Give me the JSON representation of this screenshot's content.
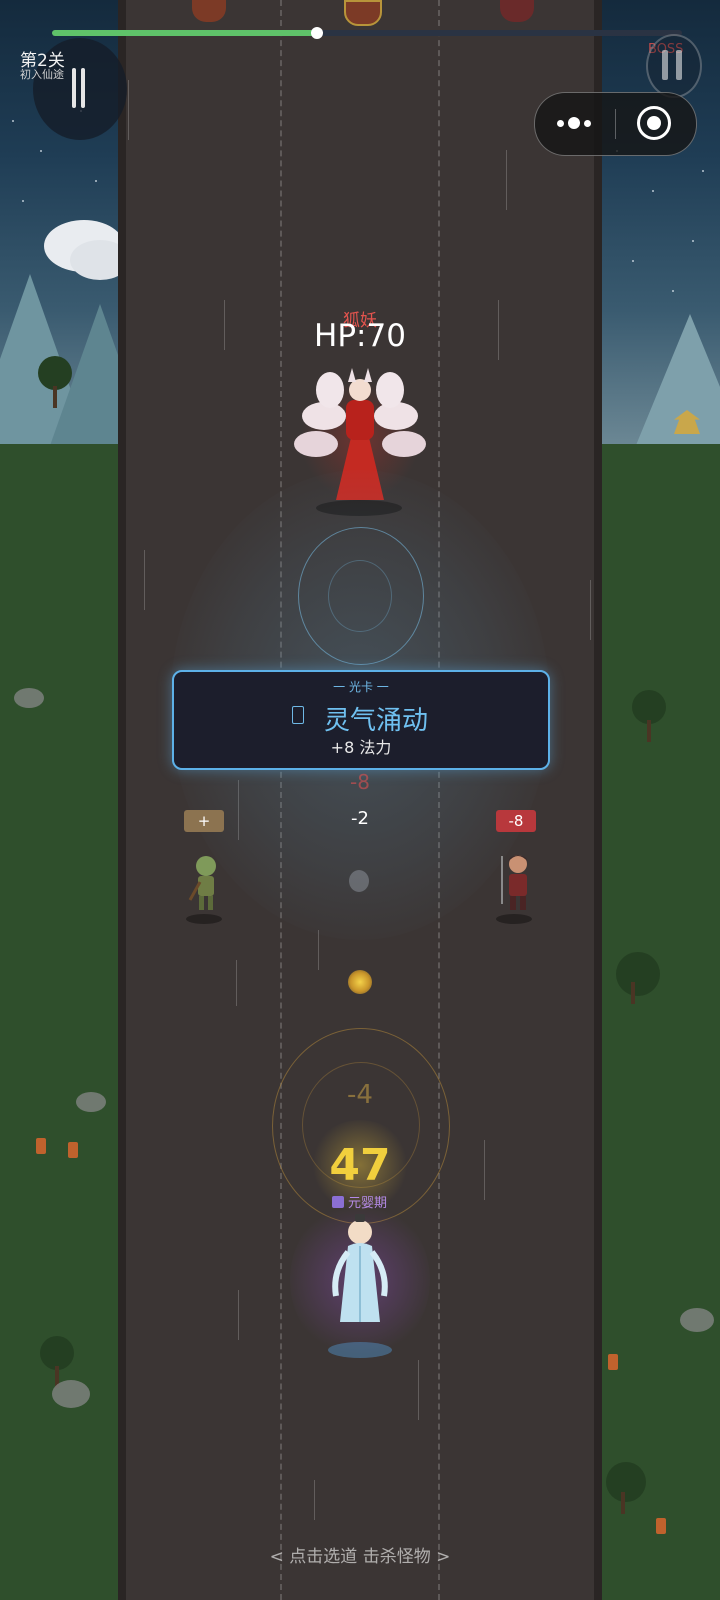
{
  "hud": {
    "level_title": "第2关",
    "level_subtitle": "初入仙途",
    "boss_label": "BOSS",
    "progress_fraction": 0.42
  },
  "mini_program": {
    "more_icon": "more-dots-icon",
    "close_icon": "target-circle-icon"
  },
  "boss": {
    "name": "狐妖",
    "hp_text": "HP:70"
  },
  "card": {
    "category": "一 光卡 一",
    "title": "灵气涌动",
    "effect": "+8 法力"
  },
  "lanes": {
    "ghost_value": "-8",
    "left_badge": "+",
    "middle_value": "-2",
    "right_badge": "-8"
  },
  "player": {
    "ghost_value": "-4",
    "power": "47",
    "realm": "元婴期"
  },
  "hint": "< 点击选道 击杀怪物 >",
  "colors": {
    "progress": "#5fc269",
    "card_border": "#5db1e8",
    "power": "#f1cf3d",
    "boss_name": "#e4544e",
    "left_badge": "#8c7350",
    "right_badge": "#b8383c"
  }
}
